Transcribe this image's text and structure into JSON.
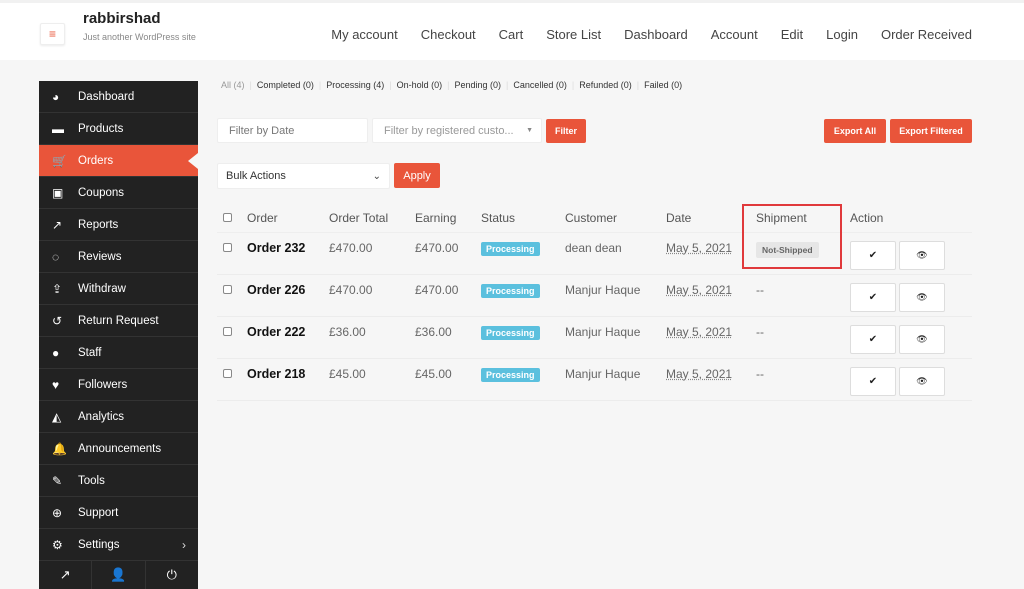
{
  "header": {
    "site_title": "rabbirshad",
    "site_description": "Just another WordPress site",
    "menu_icon": "hamburger-icon",
    "nav": [
      "My account",
      "Checkout",
      "Cart",
      "Store List",
      "Dashboard",
      "Account",
      "Edit",
      "Login",
      "Order Received"
    ]
  },
  "sidebar": {
    "items": [
      {
        "label": "Dashboard",
        "icon": "dashboard-icon",
        "glyph": "◕",
        "active": false
      },
      {
        "label": "Products",
        "icon": "briefcase-icon",
        "glyph": "▬",
        "active": false
      },
      {
        "label": "Orders",
        "icon": "cart-icon",
        "glyph": "🛒",
        "active": true
      },
      {
        "label": "Coupons",
        "icon": "gift-icon",
        "glyph": "▣",
        "active": false
      },
      {
        "label": "Reports",
        "icon": "line-chart-icon",
        "glyph": "↗",
        "active": false
      },
      {
        "label": "Reviews",
        "icon": "comments-icon",
        "glyph": "◌",
        "active": false
      },
      {
        "label": "Withdraw",
        "icon": "upload-icon",
        "glyph": "⇪",
        "active": false
      },
      {
        "label": "Return Request",
        "icon": "undo-icon",
        "glyph": "↺",
        "active": false
      },
      {
        "label": "Staff",
        "icon": "users-icon",
        "glyph": "●",
        "active": false
      },
      {
        "label": "Followers",
        "icon": "heart-icon",
        "glyph": "♥",
        "active": false
      },
      {
        "label": "Analytics",
        "icon": "area-chart-icon",
        "glyph": "◭",
        "active": false
      },
      {
        "label": "Announcements",
        "icon": "bell-icon",
        "glyph": "🔔",
        "active": false
      },
      {
        "label": "Tools",
        "icon": "wrench-icon",
        "glyph": "✎",
        "active": false
      },
      {
        "label": "Support",
        "icon": "life-ring-icon",
        "glyph": "⊕",
        "active": false
      },
      {
        "label": "Settings",
        "icon": "gear-icon",
        "glyph": "⚙",
        "active": false,
        "has_submenu": true
      }
    ],
    "submenu_arrow": "›",
    "footer": [
      {
        "icon": "external-link-icon",
        "glyph": "↗"
      },
      {
        "icon": "user-icon",
        "glyph": "👤"
      },
      {
        "icon": "power-icon",
        "glyph": "⏻"
      }
    ]
  },
  "status_filter": [
    {
      "label": "All (4)",
      "current": true
    },
    {
      "label": "Completed (0)",
      "current": false
    },
    {
      "label": "Processing (4)",
      "current": false
    },
    {
      "label": "On-hold (0)",
      "current": false
    },
    {
      "label": "Pending (0)",
      "current": false
    },
    {
      "label": "Cancelled (0)",
      "current": false
    },
    {
      "label": "Refunded (0)",
      "current": false
    },
    {
      "label": "Failed (0)",
      "current": false
    }
  ],
  "filters": {
    "date_placeholder": "Filter by Date",
    "customer_placeholder": "Filter by registered custo...",
    "filter_button": "Filter",
    "export_all": "Export All",
    "export_filtered": "Export Filtered"
  },
  "bulk": {
    "selected": "Bulk Actions",
    "apply": "Apply"
  },
  "table": {
    "headers": {
      "order": "Order",
      "total": "Order Total",
      "earning": "Earning",
      "status": "Status",
      "customer": "Customer",
      "date": "Date",
      "shipment": "Shipment",
      "action": "Action"
    },
    "rows": [
      {
        "order": "Order 232",
        "total": "£470.00",
        "earning": "£470.00",
        "status": "Processing",
        "customer": "dean dean",
        "date": "May 5, 2021",
        "shipment": "Not-Shipped"
      },
      {
        "order": "Order 226",
        "total": "£470.00",
        "earning": "£470.00",
        "status": "Processing",
        "customer": "Manjur Haque",
        "date": "May 5, 2021",
        "shipment": "--"
      },
      {
        "order": "Order 222",
        "total": "£36.00",
        "earning": "£36.00",
        "status": "Processing",
        "customer": "Manjur Haque",
        "date": "May 5, 2021",
        "shipment": "--"
      },
      {
        "order": "Order 218",
        "total": "£45.00",
        "earning": "£45.00",
        "status": "Processing",
        "customer": "Manjur Haque",
        "date": "May 5, 2021",
        "shipment": "--"
      }
    ],
    "action_icons": {
      "complete": "✔",
      "view": "👁"
    }
  },
  "colors": {
    "accent": "#e9553a",
    "sidebar_bg": "#222222",
    "processing_badge": "#5bc0de",
    "highlight": "#e0393b"
  }
}
